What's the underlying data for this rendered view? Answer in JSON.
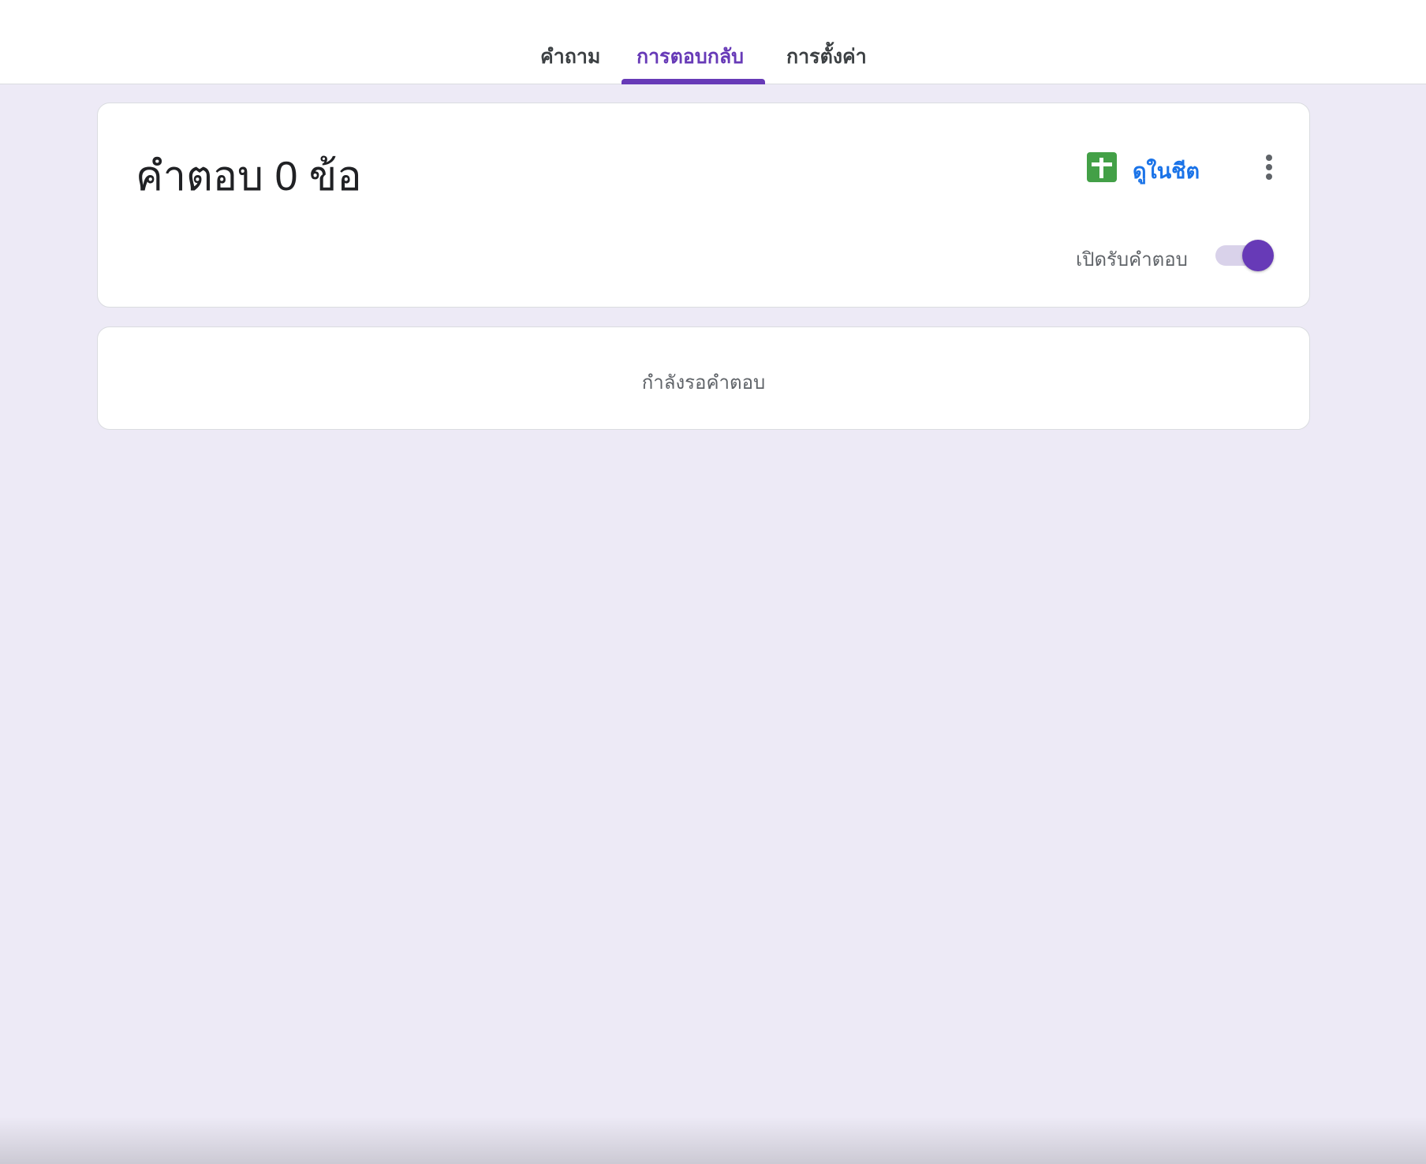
{
  "tabs": [
    {
      "label": "คำถาม",
      "active": false
    },
    {
      "label": "การตอบกลับ",
      "active": true
    },
    {
      "label": "การตั้งค่า",
      "active": false
    }
  ],
  "summary": {
    "title": "คำตอบ 0 ข้อ",
    "sheets_icon": "google-sheets-icon",
    "sheets_link": "ดูในชีต",
    "more_icon": "more-vert-icon",
    "accepting_label": "เปิดรับคำตอบ",
    "accepting_enabled": true
  },
  "status": {
    "message": "กำลังรอคำตอบ"
  },
  "colors": {
    "accent": "#673ab7",
    "link": "#1a73e8",
    "sheets": "#43a047",
    "background": "#edeaf6"
  }
}
